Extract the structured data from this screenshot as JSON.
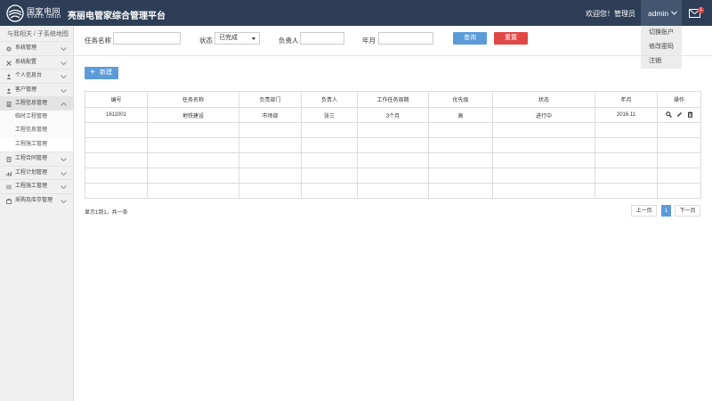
{
  "header": {
    "logo_cn": "国家电网",
    "logo_en": "STATE GRID",
    "title": "亮丽电管家综合管理平台",
    "welcome": "欢迎您！管理员",
    "user": "admin",
    "mail_badge": "1"
  },
  "user_dropdown": [
    "切换账户",
    "修改密码",
    "注销"
  ],
  "sidebar": {
    "breadcrumb": "与我相关 / 子系统地图",
    "items": [
      {
        "label": "系统管理",
        "icon": "gear-icon"
      },
      {
        "label": "系统配置",
        "icon": "wrench-icon"
      },
      {
        "label": "个人信息台",
        "icon": "person-icon"
      },
      {
        "label": "客户管理",
        "icon": "person-icon"
      },
      {
        "label": "工程信息管理",
        "icon": "document-icon"
      },
      {
        "label": "工程合同管理",
        "icon": "document-icon"
      },
      {
        "label": "工程计划管理",
        "icon": "chart-icon"
      },
      {
        "label": "工程施工管理",
        "icon": "tools-icon"
      },
      {
        "label": "采购及库存管理",
        "icon": "box-icon"
      }
    ],
    "subitems": [
      "临时工程管理",
      "工程信息管理",
      "工程施工管理"
    ]
  },
  "filters": {
    "task_name_label": "任务名称",
    "status_label": "状态",
    "status_value": "已完成",
    "owner_label": "负责人",
    "month_label": "年月",
    "search_button": "查询",
    "reset_button": "重置"
  },
  "new_button": "新建",
  "table": {
    "columns": [
      "编号",
      "任务名称",
      "负责部门",
      "负责人",
      "工作任务周期",
      "优先级",
      "状态",
      "年月",
      "操作"
    ],
    "rows": [
      [
        "1611001",
        "地铁建设",
        "市场部",
        "张三",
        "3个月",
        "高",
        "进行中",
        "2016.11"
      ]
    ]
  },
  "summary": "显示1到1，共一条",
  "pagination": {
    "prev": "上一页",
    "current": "1",
    "next": "下一页"
  },
  "colors": {
    "header_bg": "#2d3e56",
    "primary": "#5b9bd8",
    "danger": "#e04848"
  }
}
